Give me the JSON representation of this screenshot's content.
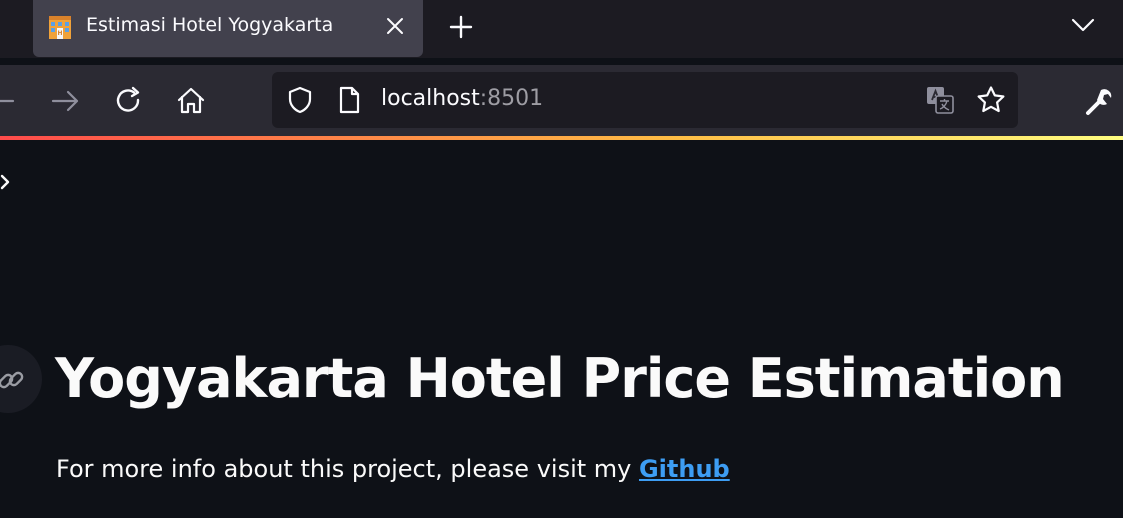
{
  "browser": {
    "tab": {
      "title": "Estimasi Hotel Yogyakarta",
      "favicon": "hotel-icon"
    },
    "url": {
      "host": "localhost",
      "port": ":8501"
    }
  },
  "page": {
    "title": "Yogyakarta Hotel Price Estimation",
    "info_text": "For more info about this project, please visit my ",
    "info_link": "Github"
  },
  "colors": {
    "background": "#0e1117",
    "tabstrip": "#1c1b22",
    "toolbar": "#2b2a33",
    "link": "#3d9df3",
    "text": "#fafafa"
  }
}
